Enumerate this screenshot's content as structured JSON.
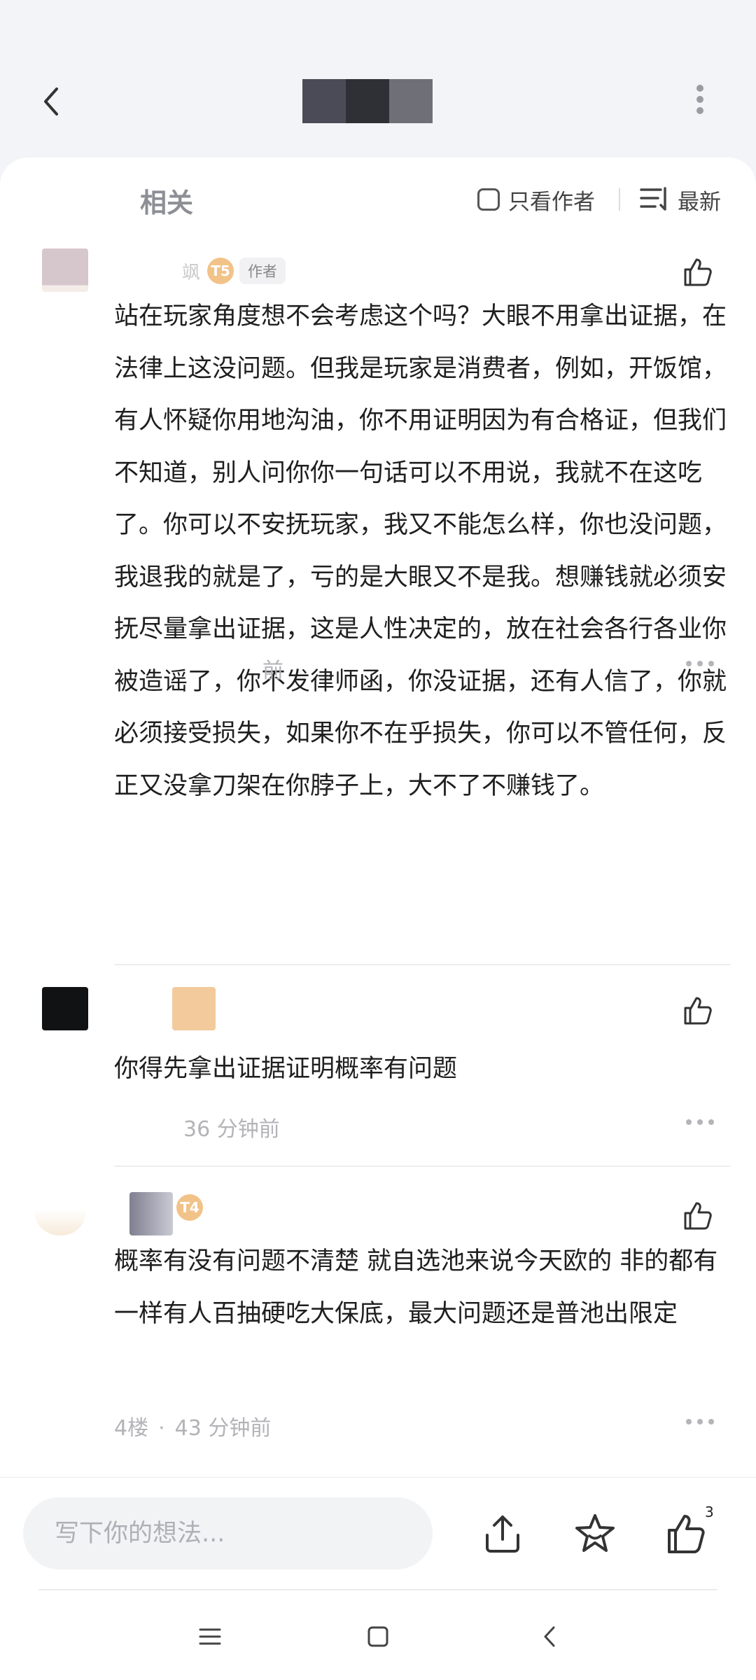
{
  "header": {
    "back_icon": "chevron-left-icon",
    "title_colors": [
      "#4a4b56",
      "#2f3036",
      "#6f7077"
    ],
    "more_icon": "vertical-dots-icon"
  },
  "filter": {
    "section_title": "相关",
    "only_author_label": "只看作者",
    "sort_label": "最新"
  },
  "comments": [
    {
      "username": "飒",
      "level": "T5",
      "author_tag": "作者",
      "content": "站在玩家角度想不会考虑这个吗？大眼不用拿出证据，在法律上这没问题。但我是玩家是消费者，例如，开饭馆，有人怀疑你用地沟油，你不用证明因为有合格证，但我们不知道，别人问你你一句话可以不用说，我就不在这吃了。你可以不安抚玩家，我又不能怎么样，你也没问题，我退我的就是了，亏的是大眼又不是我。想赚钱就必须安抚尽量拿出证据，这是人性决定的，放在社会各行各业你被造谣了，你不发律师函，你没证据，还有人信了，你就必须接受损失，如果你不在乎损失，你可以不管任何，反正又没拿刀架在你脖子上，大不了不赚钱了。",
      "time": "前"
    },
    {
      "content": "你得先拿出证据证明概率有问题",
      "time": "36 分钟前"
    },
    {
      "level": "T4",
      "content": "概率有没有问题不清楚 就自选池来说今天欧的 非的都有 一样有人百抽硬吃大保底，最大问题还是普池出限定",
      "floor": "4楼",
      "time": "43 分钟前"
    }
  ],
  "bottom_bar": {
    "input_placeholder": "写下你的想法...",
    "share_icon": "share-icon",
    "favorite_icon": "star-icon",
    "like_icon": "thumbs-up-icon",
    "like_count": "3"
  },
  "navbar": {
    "menu_icon": "menu-icon",
    "home_icon": "home-square-icon",
    "back_icon": "back-triangle-icon"
  }
}
